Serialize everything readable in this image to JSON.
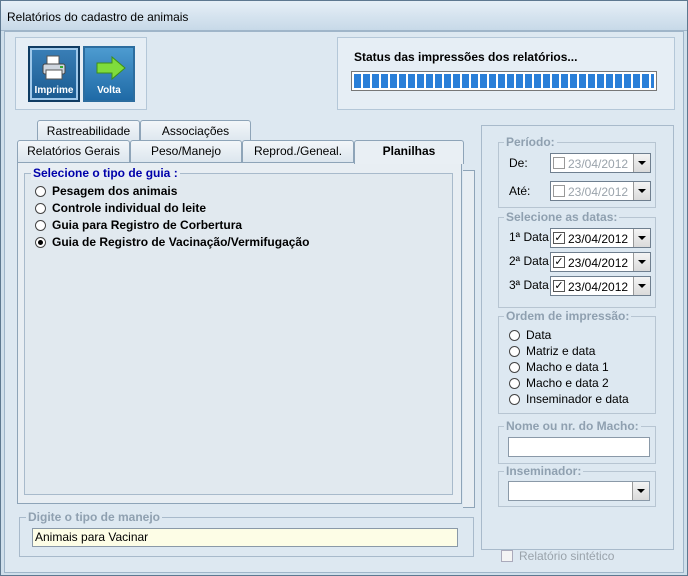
{
  "window": {
    "title": "Relatórios do cadastro de animais"
  },
  "toolbar": {
    "imprime_label": "Imprime",
    "volta_label": "Volta"
  },
  "status": {
    "title": "Status das impressões dos relatórios...",
    "progress": 1.0
  },
  "tabs": {
    "row1": [
      {
        "label": "Rastreabilidade"
      },
      {
        "label": "Associações"
      }
    ],
    "row2": [
      {
        "label": "Relatórios Gerais"
      },
      {
        "label": "Peso/Manejo"
      },
      {
        "label": "Reprod./Geneal."
      },
      {
        "label": "Planilhas",
        "active": true
      }
    ]
  },
  "guide": {
    "legend": "Selecione o tipo de guia :",
    "options": [
      {
        "label": "Pesagem dos animais",
        "checked": false
      },
      {
        "label": "Controle individual do leite",
        "checked": false
      },
      {
        "label": "Guia para Registro de Corbertura",
        "checked": false
      },
      {
        "label": "Guia de Registro de Vacinação/Vermifugação",
        "checked": true
      }
    ]
  },
  "manejo": {
    "legend": "Digite o tipo de manejo",
    "value": "Animais para Vacinar"
  },
  "periodo": {
    "legend": "Período:",
    "de_label": "De:",
    "de_value": "23/04/2012",
    "ate_label": "Até:",
    "ate_value": "23/04/2012"
  },
  "datas": {
    "legend": "Selecione as datas:",
    "items": [
      {
        "label": "1ª Data",
        "value": "23/04/2012",
        "checked": true
      },
      {
        "label": "2ª Data",
        "value": "23/04/2012",
        "checked": true
      },
      {
        "label": "3ª Data",
        "value": "23/04/2012",
        "checked": true
      }
    ]
  },
  "ordem": {
    "legend": "Ordem de impressão:",
    "options": [
      {
        "label": "Data"
      },
      {
        "label": "Matriz e data"
      },
      {
        "label": "Macho e data 1"
      },
      {
        "label": "Macho e data 2"
      },
      {
        "label": "Inseminador e data"
      }
    ]
  },
  "macho": {
    "legend": "Nome ou nr. do Macho:",
    "value": ""
  },
  "inseminador": {
    "legend": "Inseminador:",
    "value": ""
  },
  "sintetico": {
    "label": "Relatório sintético"
  },
  "icons": {
    "imprime": "printer-icon",
    "volta": "arrow-right-icon"
  },
  "colors": {
    "legend_blue": "#0000aa",
    "progress_blue": "#2a7fd8",
    "input_yellow": "#fdfde6"
  }
}
